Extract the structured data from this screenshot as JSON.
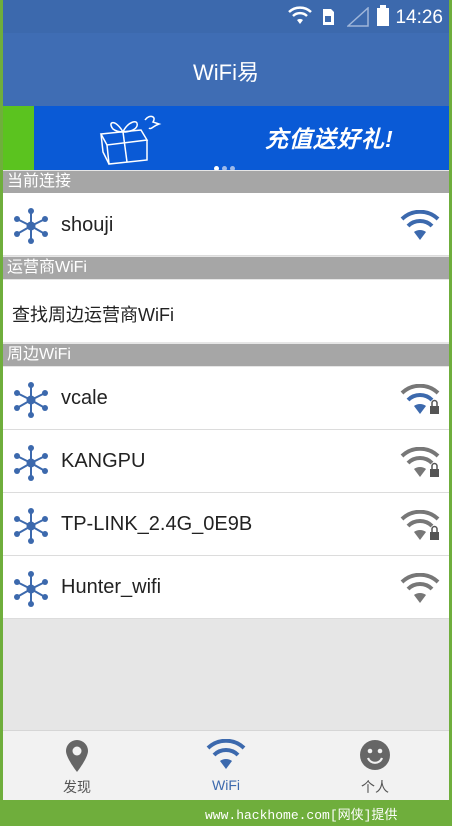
{
  "status": {
    "time": "14:26"
  },
  "app": {
    "title": "WiFi易"
  },
  "banner": {
    "slogan": "充值送好礼!"
  },
  "sections": {
    "current": "当前连接",
    "operator": "运营商WiFi",
    "nearby": "周边WiFi"
  },
  "current_connection": {
    "name": "shouji",
    "locked": false
  },
  "operator_wifi": {
    "label": "查找周边运营商WiFi"
  },
  "nearby_wifi": [
    {
      "name": "vcale",
      "locked": true
    },
    {
      "name": "KANGPU",
      "locked": true
    },
    {
      "name": "TP-LINK_2.4G_0E9B",
      "locked": true
    },
    {
      "name": "Hunter_wifi",
      "locked": false
    }
  ],
  "tabs": [
    {
      "label": "发现",
      "icon": "location-pin-icon",
      "active": false
    },
    {
      "label": "WiFi",
      "icon": "wifi-icon",
      "active": true
    },
    {
      "label": "个人",
      "icon": "smiley-face-icon",
      "active": false
    }
  ],
  "footer": {
    "watermark": "www.hackhome.com[网侠]提供"
  },
  "colors": {
    "primary": "#3f6db4",
    "section": "#a6a6a6",
    "banner": "#0a5ad6",
    "wifi_active": "#3c69ad",
    "wifi_inactive": "#777777"
  }
}
